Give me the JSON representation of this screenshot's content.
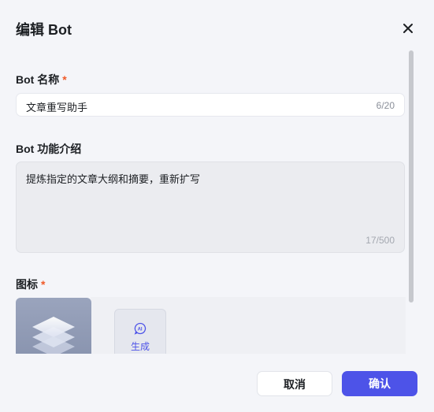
{
  "dialog": {
    "title": "编辑 Bot",
    "close_icon": "close-icon"
  },
  "fields": {
    "name": {
      "label": "Bot 名称",
      "required_mark": "*",
      "value": "文章重写助手",
      "counter": "6/20"
    },
    "description": {
      "label": "Bot 功能介绍",
      "value": "提炼指定的文章大纲和摘要，重新扩写",
      "counter": "17/500"
    },
    "icon": {
      "label": "图标",
      "required_mark": "*",
      "preview_icon": "layers-icon",
      "generate_label": "生成",
      "generate_icon": "ai-sparkle-icon"
    }
  },
  "footer": {
    "cancel_label": "取消",
    "confirm_label": "确认"
  },
  "colors": {
    "accent": "#4d53e8",
    "required": "#f05a28",
    "background": "#f4f5f9"
  }
}
